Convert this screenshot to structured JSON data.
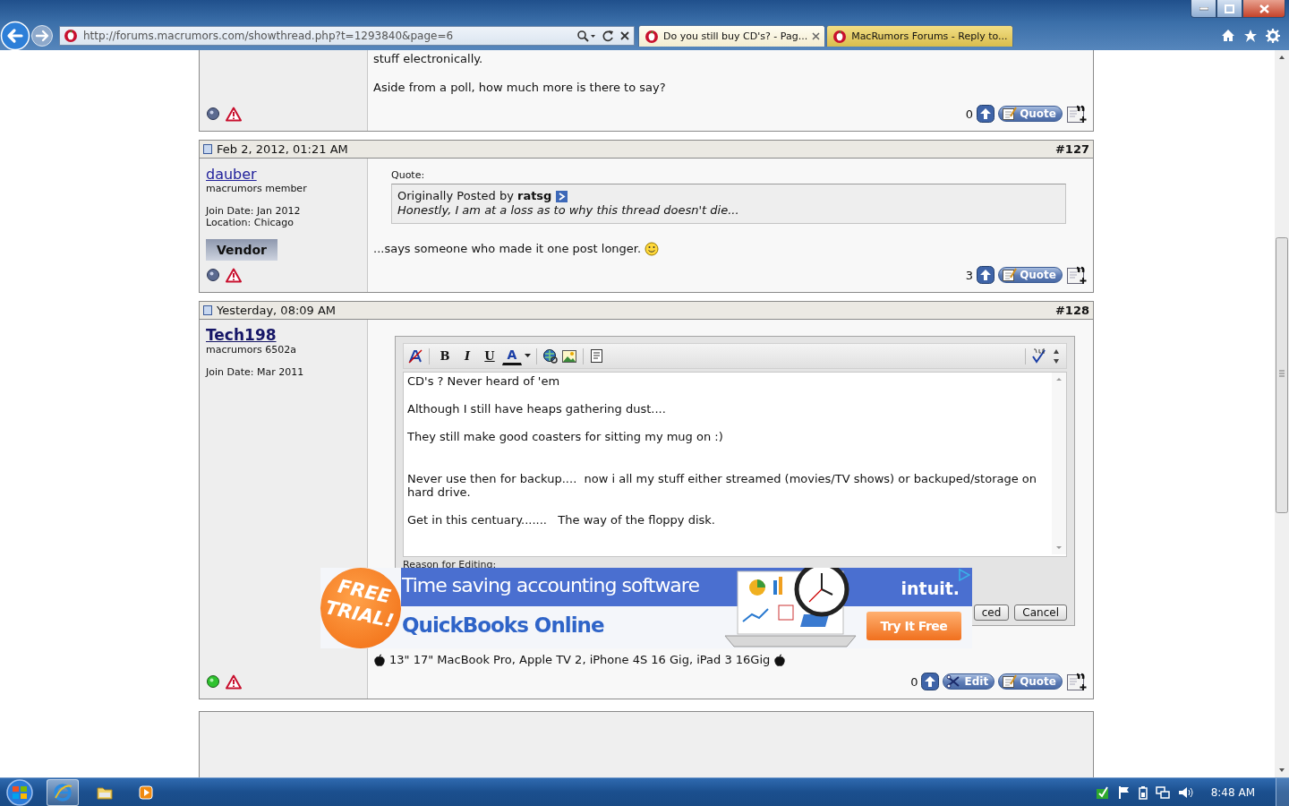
{
  "browser": {
    "url": "http://forums.macrumors.com/showthread.php?t=1293840&page=6",
    "tabs": [
      {
        "title": "Do you still buy CD's? - Pag...",
        "selected": true
      },
      {
        "title": "MacRumors Forums - Reply to...",
        "selected": false
      }
    ]
  },
  "posts": [
    {
      "blocks": [
        {
          "kind": "paragraph",
          "text": "stuff electronically."
        },
        {
          "kind": "paragraph",
          "text": "Aside from a poll, how much more is there to say?"
        }
      ],
      "online": false,
      "reputation": "0",
      "actions": [
        {
          "kind": "quote",
          "label": "Quote"
        }
      ]
    },
    {
      "date": "Feb 2, 2012, 01:21 AM",
      "number": "#127",
      "user": {
        "name": "dauber",
        "bold": false,
        "title": "macrumors member",
        "details": [
          "Join Date: Jan 2012",
          "Location: Chicago"
        ],
        "badge": "Vendor"
      },
      "blocks": [
        {
          "kind": "quote",
          "label": "Quote:",
          "byline": "Originally Posted by **ratsg**",
          "text": "Honestly, I am at a loss as to why this thread doesn't die..."
        },
        {
          "kind": "paragraph",
          "text": "...says someone who made it one post longer.",
          "smiley": true
        }
      ],
      "online": false,
      "reputation": "3",
      "actions": [
        {
          "kind": "quote",
          "label": "Quote"
        }
      ]
    },
    {
      "date": "Yesterday, 08:09 AM",
      "number": "#128",
      "user": {
        "name": "Tech198",
        "bold": true,
        "title": "macrumors 6502a",
        "details": [
          "Join Date: Mar 2011"
        ]
      },
      "blocks": [
        {
          "kind": "editor",
          "toolbar": [
            {
              "kind": "remove-format"
            },
            {
              "kind": "bold",
              "label": "B"
            },
            {
              "kind": "italic",
              "label": "I"
            },
            {
              "kind": "underline",
              "label": "U"
            },
            {
              "kind": "font-color",
              "label": "A"
            },
            {
              "kind": "link"
            },
            {
              "kind": "image"
            },
            {
              "kind": "quote"
            }
          ],
          "text": "CD's ? Never heard of 'em\n\nAlthough I still have heaps gathering dust....\n\nThey still make good coasters for sitting my mug on :)\n\n\nNever use then for backup....  now i all my stuff either streamed (movies/TV shows) or backuped/storage on hard drive.\n\nGet in this centuary.......   The way of the floppy disk.",
          "reason_label": "Reason for Editing:",
          "buttons": [
            {
              "label": "ced"
            },
            {
              "label": "Cancel"
            }
          ]
        },
        {
          "kind": "signature",
          "text": "13\" 17\" MacBook Pro, Apple TV 2, iPhone 4S 16 Gig, iPad 3 16Gig"
        }
      ],
      "online": true,
      "reputation": "0",
      "actions": [
        {
          "kind": "edit",
          "label": "Edit"
        },
        {
          "kind": "quote",
          "label": "Quote"
        }
      ]
    }
  ],
  "ad": {
    "badge": "FREE TRIAL!",
    "headline": "Time saving accounting software",
    "product": "QuickBooks Online",
    "brand": "intuit.",
    "cta": "Try It Free"
  },
  "taskbar": {
    "clock": "8:48 AM"
  }
}
